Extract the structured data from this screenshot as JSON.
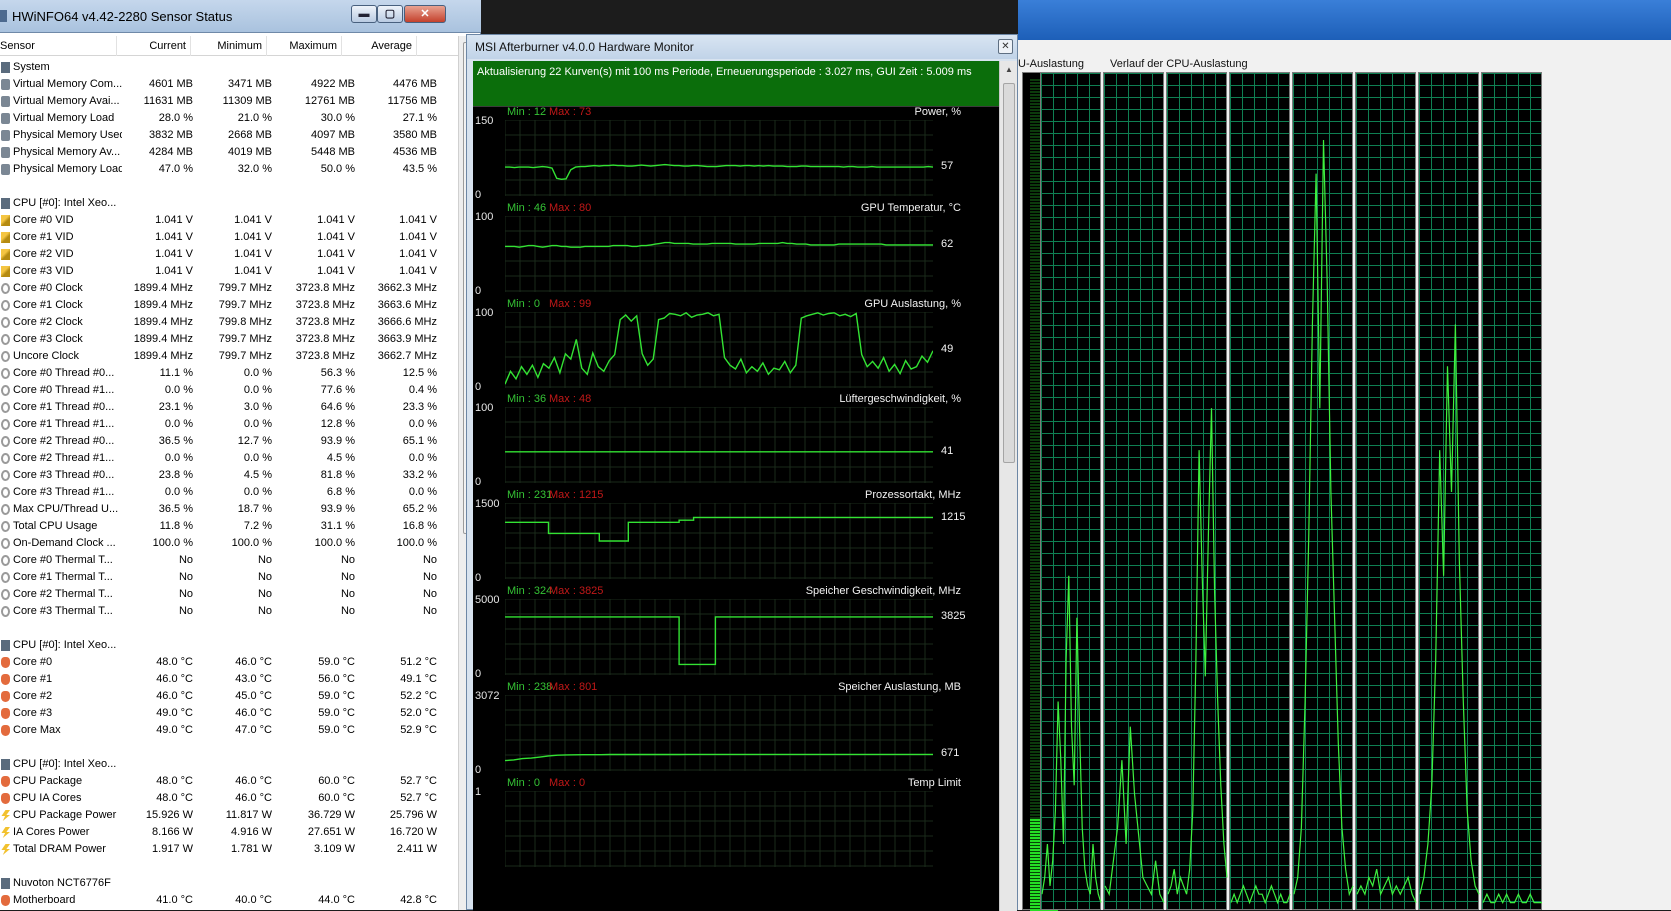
{
  "hwinfo": {
    "title": "HWiNFO64 v4.42-2280 Sensor Status",
    "window_buttons": {
      "minimize": "▬",
      "maximize": "▢",
      "close": "✕"
    },
    "columns": [
      "Sensor",
      "Current",
      "Minimum",
      "Maximum",
      "Average"
    ],
    "rows": [
      {
        "type": "group",
        "icon": "chip",
        "label": "System"
      },
      {
        "icon": "sys",
        "label": "Virtual Memory Com...",
        "cur": "4601 MB",
        "min": "3471 MB",
        "max": "4922 MB",
        "avg": "4476 MB"
      },
      {
        "icon": "sys",
        "label": "Virtual Memory Avai...",
        "cur": "11631 MB",
        "min": "11309 MB",
        "max": "12761 MB",
        "avg": "11756 MB"
      },
      {
        "icon": "sys",
        "label": "Virtual Memory Load",
        "cur": "28.0 %",
        "min": "21.0 %",
        "max": "30.0 %",
        "avg": "27.1 %"
      },
      {
        "icon": "sys",
        "label": "Physical Memory Used",
        "cur": "3832 MB",
        "min": "2668 MB",
        "max": "4097 MB",
        "avg": "3580 MB"
      },
      {
        "icon": "sys",
        "label": "Physical Memory Av...",
        "cur": "4284 MB",
        "min": "4019 MB",
        "max": "5448 MB",
        "avg": "4536 MB"
      },
      {
        "icon": "sys",
        "label": "Physical Memory Load",
        "cur": "47.0 %",
        "min": "32.0 %",
        "max": "50.0 %",
        "avg": "43.5 %"
      },
      {
        "type": "blank"
      },
      {
        "type": "group",
        "icon": "chip",
        "label": "CPU [#0]: Intel Xeo..."
      },
      {
        "icon": "vol",
        "label": "Core #0 VID",
        "cur": "1.041 V",
        "min": "1.041 V",
        "max": "1.041 V",
        "avg": "1.041 V"
      },
      {
        "icon": "vol",
        "label": "Core #1 VID",
        "cur": "1.041 V",
        "min": "1.041 V",
        "max": "1.041 V",
        "avg": "1.041 V"
      },
      {
        "icon": "vol",
        "label": "Core #2 VID",
        "cur": "1.041 V",
        "min": "1.041 V",
        "max": "1.041 V",
        "avg": "1.041 V"
      },
      {
        "icon": "vol",
        "label": "Core #3 VID",
        "cur": "1.041 V",
        "min": "1.041 V",
        "max": "1.041 V",
        "avg": "1.041 V"
      },
      {
        "icon": "clk",
        "label": "Core #0 Clock",
        "cur": "1899.4 MHz",
        "min": "799.7 MHz",
        "max": "3723.8 MHz",
        "avg": "3662.3 MHz"
      },
      {
        "icon": "clk",
        "label": "Core #1 Clock",
        "cur": "1899.4 MHz",
        "min": "799.7 MHz",
        "max": "3723.8 MHz",
        "avg": "3663.6 MHz"
      },
      {
        "icon": "clk",
        "label": "Core #2 Clock",
        "cur": "1899.4 MHz",
        "min": "799.8 MHz",
        "max": "3723.8 MHz",
        "avg": "3666.6 MHz"
      },
      {
        "icon": "clk",
        "label": "Core #3 Clock",
        "cur": "1899.4 MHz",
        "min": "799.7 MHz",
        "max": "3723.8 MHz",
        "avg": "3663.9 MHz"
      },
      {
        "icon": "clk",
        "label": "Uncore Clock",
        "cur": "1899.4 MHz",
        "min": "799.7 MHz",
        "max": "3723.8 MHz",
        "avg": "3662.7 MHz"
      },
      {
        "icon": "clk",
        "label": "Core #0 Thread #0...",
        "cur": "11.1 %",
        "min": "0.0 %",
        "max": "56.3 %",
        "avg": "12.5 %"
      },
      {
        "icon": "clk",
        "label": "Core #0 Thread #1...",
        "cur": "0.0 %",
        "min": "0.0 %",
        "max": "77.6 %",
        "avg": "0.4 %"
      },
      {
        "icon": "clk",
        "label": "Core #1 Thread #0...",
        "cur": "23.1 %",
        "min": "3.0 %",
        "max": "64.6 %",
        "avg": "23.3 %"
      },
      {
        "icon": "clk",
        "label": "Core #1 Thread #1...",
        "cur": "0.0 %",
        "min": "0.0 %",
        "max": "12.8 %",
        "avg": "0.0 %"
      },
      {
        "icon": "clk",
        "label": "Core #2 Thread #0...",
        "cur": "36.5 %",
        "min": "12.7 %",
        "max": "93.9 %",
        "avg": "65.1 %"
      },
      {
        "icon": "clk",
        "label": "Core #2 Thread #1...",
        "cur": "0.0 %",
        "min": "0.0 %",
        "max": "4.5 %",
        "avg": "0.0 %"
      },
      {
        "icon": "clk",
        "label": "Core #3 Thread #0...",
        "cur": "23.8 %",
        "min": "4.5 %",
        "max": "81.8 %",
        "avg": "33.2 %"
      },
      {
        "icon": "clk",
        "label": "Core #3 Thread #1...",
        "cur": "0.0 %",
        "min": "0.0 %",
        "max": "6.8 %",
        "avg": "0.0 %"
      },
      {
        "icon": "clk",
        "label": "Max CPU/Thread U...",
        "cur": "36.5 %",
        "min": "18.7 %",
        "max": "93.9 %",
        "avg": "65.2 %"
      },
      {
        "icon": "clk",
        "label": "Total CPU Usage",
        "cur": "11.8 %",
        "min": "7.2 %",
        "max": "31.1 %",
        "avg": "16.8 %"
      },
      {
        "icon": "clk",
        "label": "On-Demand Clock ...",
        "cur": "100.0 %",
        "min": "100.0 %",
        "max": "100.0 %",
        "avg": "100.0 %"
      },
      {
        "icon": "clk",
        "label": "Core #0 Thermal T...",
        "cur": "No",
        "min": "No",
        "max": "No",
        "avg": "No"
      },
      {
        "icon": "clk",
        "label": "Core #1 Thermal T...",
        "cur": "No",
        "min": "No",
        "max": "No",
        "avg": "No"
      },
      {
        "icon": "clk",
        "label": "Core #2 Thermal T...",
        "cur": "No",
        "min": "No",
        "max": "No",
        "avg": "No"
      },
      {
        "icon": "clk",
        "label": "Core #3 Thermal T...",
        "cur": "No",
        "min": "No",
        "max": "No",
        "avg": "No"
      },
      {
        "type": "blank"
      },
      {
        "type": "group",
        "icon": "chip",
        "label": "CPU [#0]: Intel Xeo..."
      },
      {
        "icon": "tmp",
        "label": "Core #0",
        "cur": "48.0 °C",
        "min": "46.0 °C",
        "max": "59.0 °C",
        "avg": "51.2 °C"
      },
      {
        "icon": "tmp",
        "label": "Core #1",
        "cur": "46.0 °C",
        "min": "43.0 °C",
        "max": "56.0 °C",
        "avg": "49.1 °C"
      },
      {
        "icon": "tmp",
        "label": "Core #2",
        "cur": "46.0 °C",
        "min": "45.0 °C",
        "max": "59.0 °C",
        "avg": "52.2 °C"
      },
      {
        "icon": "tmp",
        "label": "Core #3",
        "cur": "49.0 °C",
        "min": "46.0 °C",
        "max": "59.0 °C",
        "avg": "52.0 °C"
      },
      {
        "icon": "tmp",
        "label": "Core Max",
        "cur": "49.0 °C",
        "min": "47.0 °C",
        "max": "59.0 °C",
        "avg": "52.9 °C"
      },
      {
        "type": "blank"
      },
      {
        "type": "group",
        "icon": "chip",
        "label": "CPU [#0]: Intel Xeo..."
      },
      {
        "icon": "tmp",
        "label": "CPU Package",
        "cur": "48.0 °C",
        "min": "46.0 °C",
        "max": "60.0 °C",
        "avg": "52.7 °C"
      },
      {
        "icon": "tmp",
        "label": "CPU IA Cores",
        "cur": "48.0 °C",
        "min": "46.0 °C",
        "max": "60.0 °C",
        "avg": "52.7 °C"
      },
      {
        "icon": "pwr",
        "label": "CPU Package Power",
        "cur": "15.926 W",
        "min": "11.817 W",
        "max": "36.729 W",
        "avg": "25.796 W"
      },
      {
        "icon": "pwr",
        "label": "IA Cores Power",
        "cur": "8.166 W",
        "min": "4.916 W",
        "max": "27.651 W",
        "avg": "16.720 W"
      },
      {
        "icon": "pwr",
        "label": "Total DRAM Power",
        "cur": "1.917 W",
        "min": "1.781 W",
        "max": "3.109 W",
        "avg": "2.411 W"
      },
      {
        "type": "blank"
      },
      {
        "type": "group",
        "icon": "chip",
        "label": "Nuvoton NCT6776F"
      },
      {
        "icon": "tmp",
        "label": "Motherboard",
        "cur": "41.0 °C",
        "min": "40.0 °C",
        "max": "44.0 °C",
        "avg": "42.8 °C"
      }
    ]
  },
  "afterburner": {
    "title": "MSI Afterburner v4.0.0 Hardware Monitor",
    "close_label": "✕",
    "status": "Aktualisierung 22 Kurven(s) mit 100 ms Periode, Erneuerungsperiode : 3.027 ms, GUI Zeit : 5.009 ms",
    "graphs": [
      {
        "name": "Power, %",
        "ymax": "150",
        "ymin": "0",
        "min_label": "Min : 12",
        "max_label": "Max : 73",
        "current": "57",
        "range": [
          0,
          150
        ],
        "values": [
          57,
          57,
          56,
          57,
          57,
          57,
          56,
          57,
          58,
          57,
          55,
          35,
          33,
          34,
          52,
          57,
          58,
          58,
          59,
          60,
          59,
          60,
          60,
          61,
          60,
          60,
          59,
          59,
          60,
          61,
          60,
          59,
          60,
          61,
          62,
          61,
          60,
          60,
          59,
          59,
          60,
          60,
          59,
          58,
          58,
          58,
          59,
          60,
          60,
          60,
          59,
          60,
          60,
          59,
          60,
          59,
          60,
          59,
          59,
          59,
          58,
          58,
          58,
          59,
          59,
          58,
          58,
          58,
          58,
          58,
          58,
          58,
          57,
          58,
          58,
          57,
          57,
          57,
          58,
          57,
          57,
          57,
          57,
          57,
          57,
          57,
          57,
          57,
          57,
          57,
          58,
          57
        ]
      },
      {
        "name": "GPU Temperatur, °C",
        "ymax": "100",
        "ymin": "0",
        "min_label": "Min : 46",
        "max_label": "Max : 80",
        "current": "62",
        "range": [
          0,
          100
        ],
        "values": [
          60,
          60,
          60,
          59,
          60,
          61,
          61,
          60,
          59,
          60,
          61,
          61,
          60,
          60,
          59,
          59,
          59,
          60,
          60,
          60,
          60,
          60,
          60,
          61,
          61,
          61,
          61,
          60,
          60,
          61,
          61,
          62,
          63,
          64,
          65,
          65,
          64,
          64,
          64,
          64,
          63,
          63,
          63,
          63,
          64,
          64,
          64,
          64,
          64,
          63,
          63,
          63,
          63,
          63,
          64,
          64,
          64,
          64,
          64,
          65,
          64,
          64,
          63,
          63,
          63,
          62,
          62,
          62,
          62,
          62,
          62,
          63,
          63,
          63,
          63,
          63,
          63,
          63,
          63,
          63,
          63,
          62,
          62,
          62,
          62,
          62,
          62,
          62,
          62,
          62,
          62,
          62
        ]
      },
      {
        "name": "GPU Auslastung, %",
        "ymax": "100",
        "ymin": "0",
        "min_label": "Min : 0",
        "max_label": "Max : 99",
        "current": "49",
        "range": [
          0,
          100
        ],
        "values": [
          5,
          22,
          12,
          28,
          18,
          30,
          14,
          32,
          26,
          40,
          20,
          45,
          38,
          64,
          26,
          18,
          46,
          28,
          22,
          36,
          44,
          90,
          96,
          88,
          95,
          45,
          30,
          38,
          90,
          92,
          98,
          97,
          95,
          99,
          93,
          96,
          97,
          99,
          95,
          97,
          40,
          30,
          25,
          38,
          20,
          28,
          22,
          33,
          18,
          26,
          24,
          35,
          20,
          30,
          92,
          95,
          97,
          99,
          96,
          98,
          99,
          95,
          97,
          94,
          98,
          44,
          28,
          35,
          26,
          40,
          22,
          31,
          19,
          36,
          25,
          28,
          42,
          34,
          49
        ]
      },
      {
        "name": "Lüftergeschwindigkeit, %",
        "ymax": "100",
        "ymin": "0",
        "min_label": "Min : 36",
        "max_label": "Max : 48",
        "current": "41",
        "range": [
          0,
          100
        ],
        "values": [
          41,
          41,
          41,
          41,
          41,
          41,
          41,
          41,
          41,
          41,
          41,
          41,
          41,
          41,
          41,
          41,
          41,
          41,
          41,
          41,
          41,
          41,
          41,
          41,
          41,
          41,
          41,
          41,
          41,
          41,
          41,
          41,
          41,
          41,
          41,
          41,
          41,
          41,
          41,
          41
        ]
      },
      {
        "name": "Prozessortakt, MHz",
        "ymax": "1500",
        "ymin": "0",
        "min_label": "Min : 231",
        "max_label": "Max : 1215",
        "current": "1215",
        "range": [
          0,
          1500
        ],
        "values": [
          1120,
          1120,
          1120,
          1120,
          1120,
          1120,
          900,
          900,
          900,
          900,
          900,
          900,
          900,
          750,
          750,
          750,
          750,
          1120,
          1120,
          1120,
          1120,
          1120,
          1120,
          1120,
          1160,
          1160,
          1215,
          1215,
          1215,
          1215,
          1215,
          1215,
          1215,
          1215,
          1215,
          1215,
          1215,
          1215,
          1215,
          1215,
          1215,
          1215,
          1215,
          1215,
          1215,
          1215,
          1215,
          1215,
          1215,
          1215,
          1215,
          1215,
          1215,
          1215,
          1215,
          1215,
          1215,
          1215,
          1215,
          1215
        ]
      },
      {
        "name": "Speicher Geschwindigkeit, MHz",
        "ymax": "5000",
        "ymin": "0",
        "min_label": "Min : 324",
        "max_label": "Max : 3825",
        "current": "3825",
        "range": [
          0,
          5000
        ],
        "values": [
          3825,
          3825,
          3825,
          3825,
          3825,
          3825,
          3825,
          3825,
          3825,
          3825,
          3825,
          3825,
          3825,
          3825,
          3825,
          3825,
          3825,
          3825,
          3825,
          3825,
          3825,
          3825,
          3825,
          3825,
          3825,
          3825,
          3825,
          3825,
          3825,
          3825,
          3825,
          3825,
          3825,
          3825,
          3825,
          3825,
          3825,
          3825,
          3825,
          3825,
          3825,
          3825,
          3825,
          3825,
          3825,
          3825,
          3825,
          3825,
          3825,
          3825,
          3825,
          3825,
          3825,
          3825,
          3825,
          3825,
          3825,
          3825,
          3825,
          3825
        ],
        "dip": [
          24,
          28,
          700
        ]
      },
      {
        "name": "Speicher Auslastung, MB",
        "ymax": "3072",
        "ymin": "0",
        "min_label": "Min : 238",
        "max_label": "Max : 801",
        "current": "671",
        "range": [
          0,
          3072
        ],
        "values": [
          420,
          450,
          500,
          520,
          560,
          610,
          640,
          650,
          655,
          660,
          660,
          660,
          665,
          665,
          665,
          665,
          668,
          668,
          668,
          668,
          668,
          670,
          670,
          670,
          670,
          670,
          670,
          671,
          671,
          671,
          671,
          671,
          671,
          671,
          671,
          671,
          671,
          671,
          671,
          671,
          671,
          671,
          671,
          671,
          671,
          671,
          671,
          671,
          671,
          671
        ]
      },
      {
        "name": "Temp Limit",
        "ymax": "1",
        "ymin": "",
        "min_label": "Min : 0",
        "max_label": "Max : 0",
        "current": "",
        "range": [
          0,
          1
        ],
        "values": []
      }
    ]
  },
  "taskmanager": {
    "util_label": "U-Auslastung",
    "history_label": "Verlauf der CPU-Auslastung",
    "usage_fraction": 0.11,
    "cores": [
      [
        2,
        4,
        8,
        3,
        6,
        12,
        25,
        18,
        8,
        30,
        40,
        22,
        15,
        35,
        22,
        10,
        5,
        3,
        2,
        8,
        4,
        2,
        1
      ],
      [
        3,
        2,
        6,
        10,
        18,
        8,
        22,
        14,
        9,
        4,
        3,
        2,
        6,
        2,
        1
      ],
      [
        2,
        3,
        5,
        2,
        4,
        3,
        2,
        5,
        12,
        30,
        55,
        40,
        28,
        45,
        60,
        38,
        25,
        15,
        8,
        4
      ],
      [
        1,
        2,
        1,
        2,
        3,
        2,
        1,
        2,
        3,
        2,
        2,
        1,
        2,
        3,
        2,
        1,
        2,
        1,
        1,
        2
      ],
      [
        2,
        4,
        10,
        25,
        45,
        70,
        88,
        60,
        92,
        75,
        50,
        35,
        20,
        10,
        5,
        2,
        3
      ],
      [
        2,
        3,
        2,
        4,
        3,
        5,
        2,
        3,
        4,
        2,
        3,
        2,
        3,
        4,
        2,
        1
      ],
      [
        2,
        4,
        8,
        15,
        30,
        55,
        40,
        65,
        50,
        70,
        42,
        25,
        12,
        6,
        3,
        2
      ],
      [
        1,
        2,
        1,
        1,
        2,
        1,
        2,
        1,
        1,
        2,
        1,
        1,
        2,
        1,
        1,
        1
      ]
    ]
  }
}
